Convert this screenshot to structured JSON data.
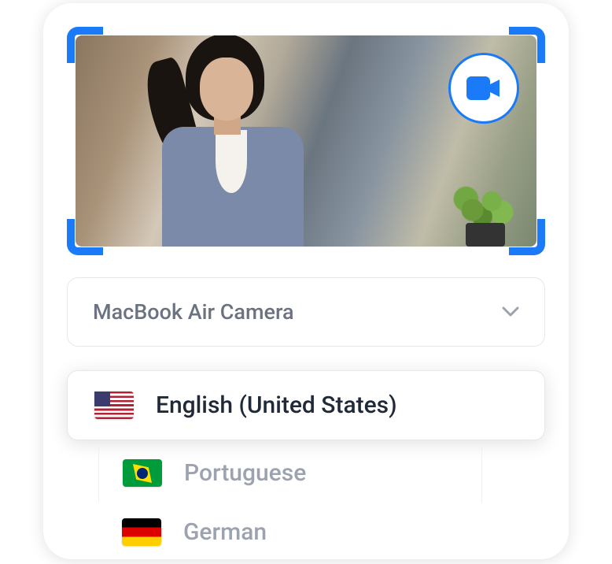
{
  "camera": {
    "selected": "MacBook Air Camera"
  },
  "languages": {
    "items": [
      {
        "label": "English (United States)",
        "flag": "us",
        "selected": true
      },
      {
        "label": "Portuguese",
        "flag": "br",
        "selected": false
      },
      {
        "label": "German",
        "flag": "de",
        "selected": false
      }
    ]
  },
  "colors": {
    "accent": "#1a7af8"
  }
}
